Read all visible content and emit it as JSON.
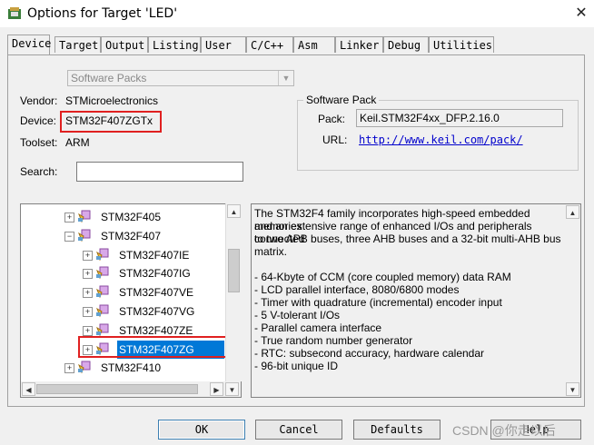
{
  "window": {
    "title": "Options for Target 'LED'",
    "close_glyph": "✕"
  },
  "tabs": [
    {
      "label": "Device",
      "active": true
    },
    {
      "label": "Target"
    },
    {
      "label": "Output"
    },
    {
      "label": "Listing"
    },
    {
      "label": "User"
    },
    {
      "label": "C/C++"
    },
    {
      "label": "Asm"
    },
    {
      "label": "Linker"
    },
    {
      "label": "Debug"
    },
    {
      "label": "Utilities"
    }
  ],
  "device_panel": {
    "source_combo": "Software Packs",
    "vendor_label": "Vendor:",
    "vendor_value": "STMicroelectronics",
    "device_label": "Device:",
    "device_value": "STM32F407ZGTx",
    "toolset_label": "Toolset:",
    "toolset_value": "ARM",
    "search_label": "Search:",
    "search_value": ""
  },
  "software_pack": {
    "title": "Software Pack",
    "pack_label": "Pack:",
    "pack_value": "Keil.STM32F4xx_DFP.2.16.0",
    "url_label": "URL:",
    "url_value": "http://www.keil.com/pack/"
  },
  "device_tree": [
    {
      "label": "STM32F405",
      "level": 1,
      "expander": "+"
    },
    {
      "label": "STM32F407",
      "level": 1,
      "expander": "−"
    },
    {
      "label": "STM32F407IE",
      "level": 2,
      "expander": "+"
    },
    {
      "label": "STM32F407IG",
      "level": 2,
      "expander": "+"
    },
    {
      "label": "STM32F407VE",
      "level": 2,
      "expander": "+"
    },
    {
      "label": "STM32F407VG",
      "level": 2,
      "expander": "+"
    },
    {
      "label": "STM32F407ZE",
      "level": 2,
      "expander": "+"
    },
    {
      "label": "STM32F407ZG",
      "level": 2,
      "expander": "+",
      "selected": true
    },
    {
      "label": "STM32F410",
      "level": 1,
      "expander": "+"
    }
  ],
  "description": {
    "lines": [
      "The STM32F4 family incorporates high-speed embedded memories",
      "and an extensive range of enhanced I/Os and peripherals connected",
      "to two APB buses, three AHB buses and a 32-bit multi-AHB bus",
      "matrix.",
      "",
      " - 64-Kbyte of CCM (core coupled memory) data RAM",
      " - LCD parallel interface, 8080/6800 modes",
      " - Timer with quadrature (incremental) encoder input",
      " - 5 V-tolerant I/Os",
      " - Parallel camera interface",
      " - True random number generator",
      " - RTC: subsecond accuracy, hardware calendar",
      " - 96-bit unique ID"
    ]
  },
  "buttons": {
    "ok": "OK",
    "cancel": "Cancel",
    "defaults": "Defaults",
    "help": "Help"
  },
  "watermark": "CSDN @你走以后",
  "colors": {
    "highlight_box": "#e02020",
    "selection": "#0078d7",
    "link": "#0000cc"
  }
}
